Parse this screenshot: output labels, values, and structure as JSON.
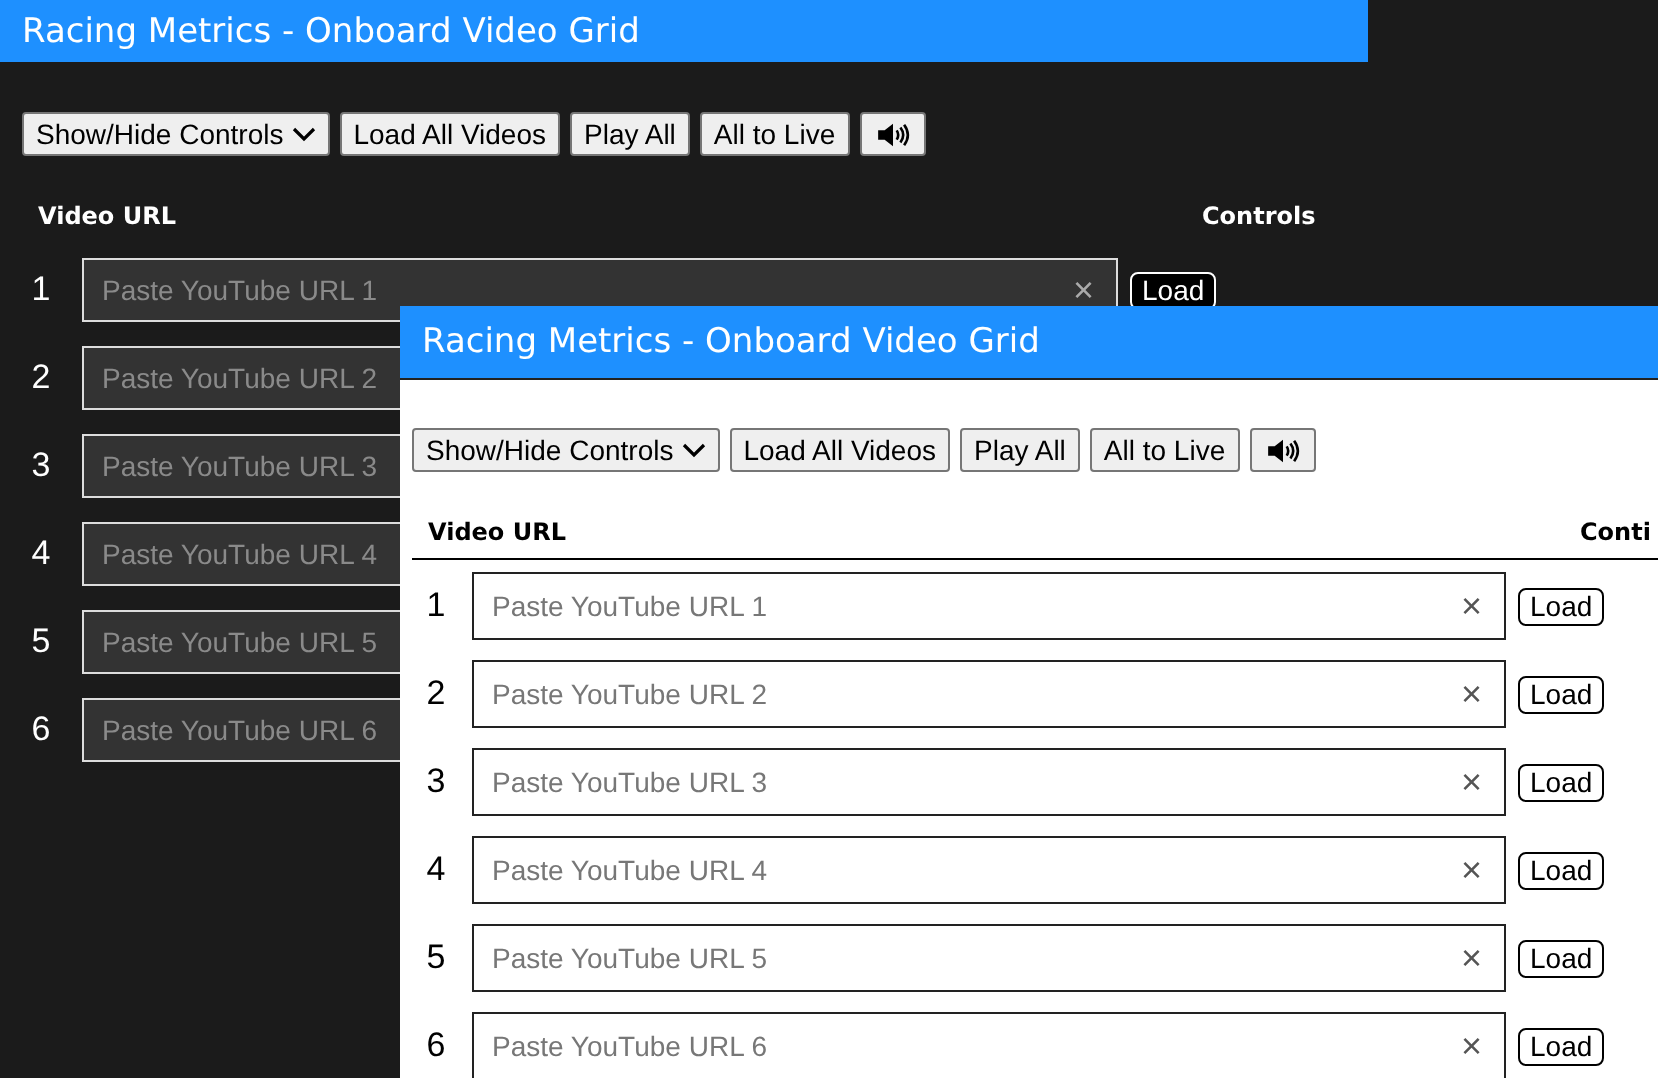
{
  "windows": [
    {
      "kind": "dark",
      "title": "Racing Metrics - Onboard Video Grid",
      "toolbar": [
        {
          "kind": "dropdown",
          "label": "Show/Hide Controls"
        },
        {
          "kind": "plain",
          "label": "Load All Videos"
        },
        {
          "kind": "plain",
          "label": "Play All"
        },
        {
          "kind": "plain",
          "label": "All to Live"
        },
        {
          "kind": "sound"
        }
      ],
      "columns": [
        "Video URL",
        "Controls"
      ],
      "rows": [
        {
          "number": "1",
          "placeholder": "Paste YouTube URL 1",
          "clear": "×",
          "load": "Load"
        },
        {
          "number": "2",
          "placeholder": "Paste YouTube URL 2"
        },
        {
          "number": "3",
          "placeholder": "Paste YouTube URL 3"
        },
        {
          "number": "4",
          "placeholder": "Paste YouTube URL 4"
        },
        {
          "number": "5",
          "placeholder": "Paste YouTube URL 5"
        },
        {
          "number": "6",
          "placeholder": "Paste YouTube URL 6"
        }
      ]
    },
    {
      "kind": "light",
      "title": "Racing Metrics - Onboard Video Grid",
      "toolbar": [
        {
          "kind": "dropdown",
          "label": "Show/Hide Controls"
        },
        {
          "kind": "plain",
          "label": "Load All Videos"
        },
        {
          "kind": "plain",
          "label": "Play All"
        },
        {
          "kind": "plain",
          "label": "All to Live"
        },
        {
          "kind": "sound"
        }
      ],
      "columns": [
        "Video URL",
        "Conti"
      ],
      "rows": [
        {
          "number": "1",
          "placeholder": "Paste YouTube URL 1",
          "clear": "×",
          "load": "Load"
        },
        {
          "number": "2",
          "placeholder": "Paste YouTube URL 2",
          "clear": "×",
          "load": "Load"
        },
        {
          "number": "3",
          "placeholder": "Paste YouTube URL 3",
          "clear": "×",
          "load": "Load"
        },
        {
          "number": "4",
          "placeholder": "Paste YouTube URL 4",
          "clear": "×",
          "load": "Load"
        },
        {
          "number": "5",
          "placeholder": "Paste YouTube URL 5",
          "clear": "×",
          "load": "Load"
        },
        {
          "number": "6",
          "placeholder": "Paste YouTube URL 6",
          "clear": "×",
          "load": "Load"
        }
      ]
    }
  ]
}
